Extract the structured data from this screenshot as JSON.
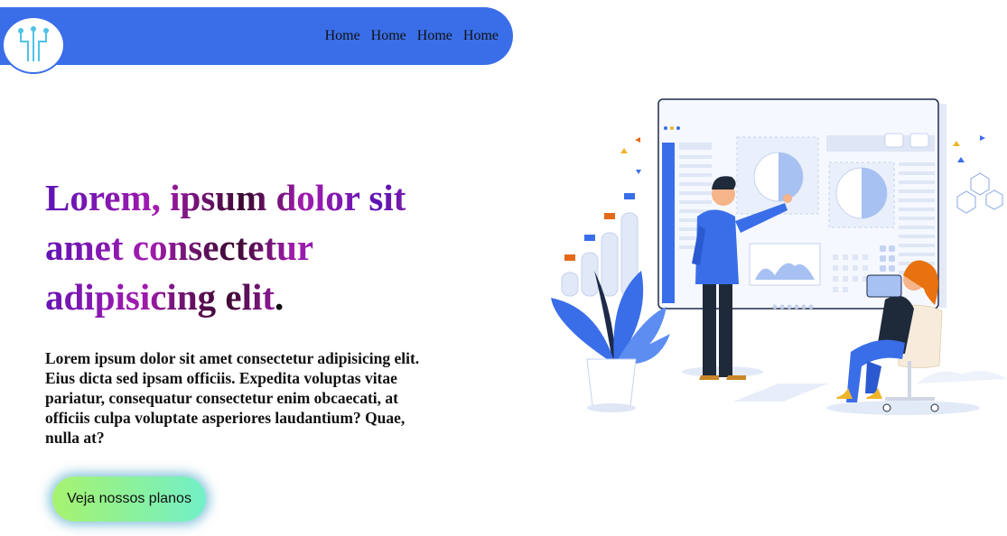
{
  "nav": {
    "logo_icon": "circuit-logo-icon",
    "links": [
      "Home",
      "Home",
      "Home",
      "Home"
    ]
  },
  "hero": {
    "headline": "Lorem, ipsum dolor sit amet consectetur adipisicing elit",
    "headline_end": ".",
    "paragraph": "Lorem ipsum dolor sit amet consectetur adipisicing elit. Eius dicta sed ipsam officiis. Expedita voluptas vitae pariatur, consequatur consectetur enim obcaecati, at officiis culpa voluptate asperiores laudantium? Quae, nulla at?",
    "cta_label": "Veja nossos planos"
  },
  "illustration": {
    "icon": "dashboard-team-illustration"
  },
  "colors": {
    "nav_bg": "#3a6ee8",
    "accent_blue": "#3a6ee8",
    "cta_start": "#a6f26e",
    "cta_end": "#72f0c8"
  }
}
